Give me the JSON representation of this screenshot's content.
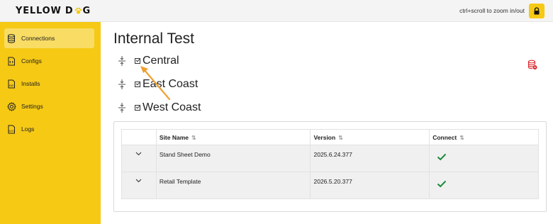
{
  "app": {
    "logo_left": "YELLOW D",
    "logo_right": "G",
    "zoom_hint": "ctrl+scroll to zoom in/out"
  },
  "sidebar": {
    "items": [
      {
        "label": "Connections",
        "icon": "database-icon",
        "active": true
      },
      {
        "label": "Configs",
        "icon": "code-file-icon",
        "active": false
      },
      {
        "label": "Installs",
        "icon": "exe-file-icon",
        "active": false
      },
      {
        "label": "Settings",
        "icon": "gear-icon",
        "active": false
      },
      {
        "label": "Logs",
        "icon": "log-file-icon",
        "active": false
      }
    ]
  },
  "main": {
    "title": "Internal Test",
    "regions": [
      {
        "name": "Central"
      },
      {
        "name": "East Coast"
      },
      {
        "name": "West Coast"
      }
    ],
    "table": {
      "headers": [
        "Site Name",
        "Version",
        "Connect"
      ],
      "rows": [
        {
          "site": "Stand Sheet Demo",
          "version": "2025.6.24.377",
          "connected": true
        },
        {
          "site": "Retail Template",
          "version": "2026.5.20.377",
          "connected": true
        }
      ]
    }
  },
  "colors": {
    "brand_yellow": "#f6c915",
    "active_item": "#f8dc63",
    "check_green": "#1e8a3c",
    "alert_red": "#d9262b",
    "annotation_arrow": "#f0a030"
  }
}
